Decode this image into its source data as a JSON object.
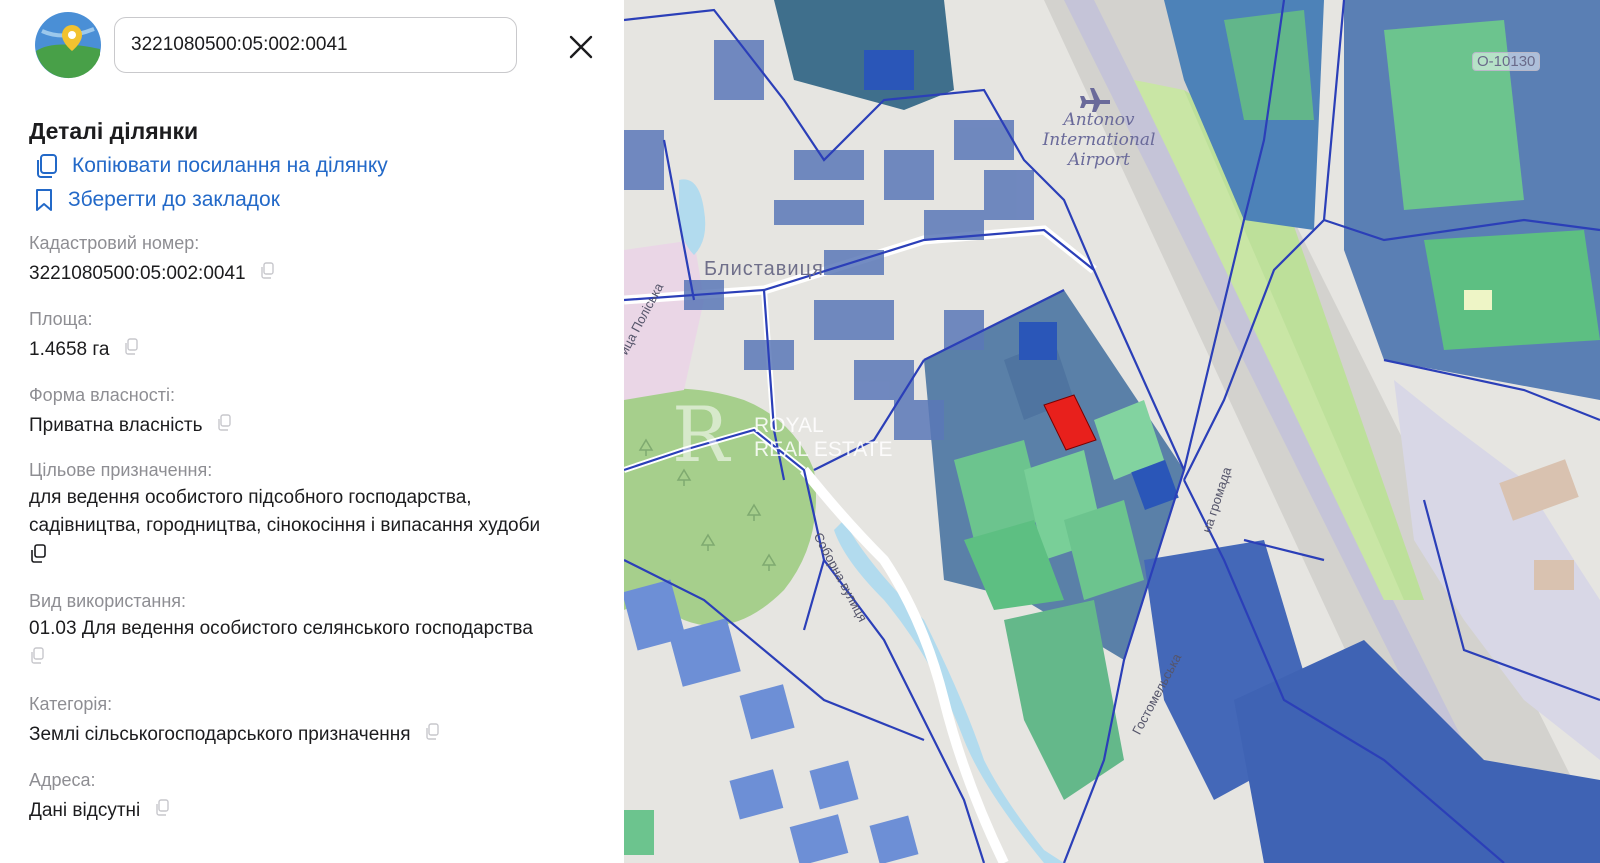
{
  "search": {
    "value": "3221080500:05:002:0041"
  },
  "panel": {
    "title": "Деталі ділянки",
    "copy_link_label": "Копіювати посилання на ділянку",
    "bookmark_label": "Зберегти до закладок"
  },
  "fields": {
    "cadastral": {
      "label": "Кадастровий номер:",
      "value": "3221080500:05:002:0041"
    },
    "area": {
      "label": "Площа:",
      "value": "1.4658 га"
    },
    "ownership": {
      "label": "Форма власності:",
      "value": "Приватна власність"
    },
    "purpose": {
      "label": "Цільове призначення:",
      "value_line1": "для ведення особистого підсобного господарства,",
      "value_line2": "садівництва, городництва, сінокосіння і випасання худоби"
    },
    "usage": {
      "label": "Вид використання:",
      "value": "01.03 Для ведення особистого селянського господарства"
    },
    "category": {
      "label": "Категорія:",
      "value": "Землі сільськогосподарського призначення"
    },
    "address": {
      "label": "Адреса:",
      "value": "Дані відсутні"
    }
  },
  "map": {
    "airport_line1": "Antonov",
    "airport_line2": "International",
    "airport_line3": "Airport",
    "village": "Блиставиця",
    "street_polyska": "ица Поліська",
    "street_soborna": "Соборна вулиця",
    "hromada": "на громада",
    "street_bottom": "Гостомельська",
    "route_label": "O-10130",
    "watermark_line1": "ROYAL",
    "watermark_line2": "REAL ESTATE",
    "highlight_color": "#e8201c",
    "parcel_blue": "#3f5fb4",
    "parcel_green": "#5ec27f"
  }
}
